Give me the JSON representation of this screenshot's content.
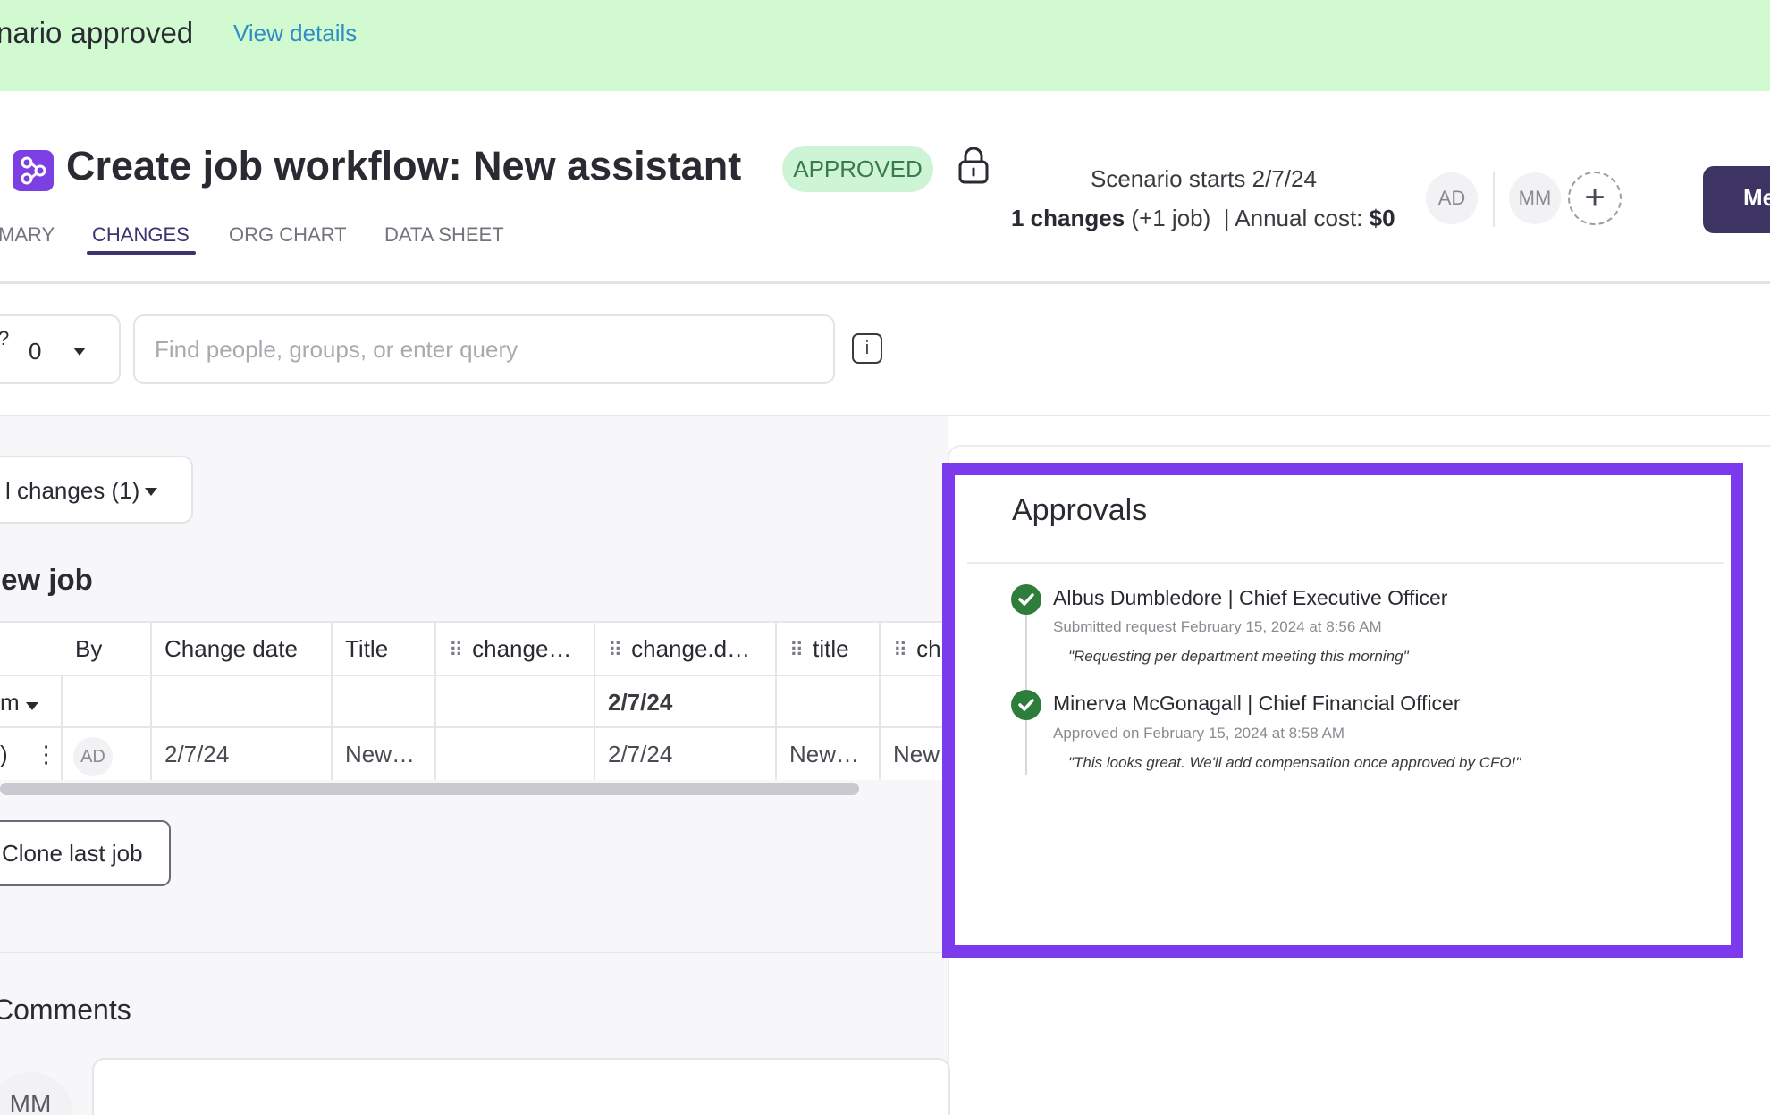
{
  "banner": {
    "message": "nario approved",
    "link": "View details"
  },
  "header": {
    "title": "Create job workflow: New assistant",
    "status_badge": "APPROVED",
    "scenario_starts": "Scenario starts 2/7/24",
    "changes_count": "1 changes",
    "changes_detail": "(+1 job)",
    "annual_cost_label": "Annual cost:",
    "annual_cost_value": "$0",
    "avatars": [
      "AD",
      "MM"
    ],
    "action_button": "Me"
  },
  "tabs": [
    "MARY",
    "CHANGES",
    "ORG CHART",
    "DATA SHEET"
  ],
  "toolbar": {
    "filter_icon": "?",
    "filter_value": "0",
    "search_placeholder": "Find people, groups, or enter query",
    "info_icon": "i"
  },
  "changes_dropdown": {
    "label": "l changes (1)"
  },
  "section": {
    "title": "lew job"
  },
  "table": {
    "columns": [
      "By",
      "Change date",
      "Title",
      "change…",
      "change.d…",
      "title",
      "ch"
    ],
    "group_row": {
      "label": "m",
      "date": "2/7/24"
    },
    "rows": [
      {
        "lead": ")",
        "by": "AD",
        "change_date": "2/7/24",
        "title": "New…",
        "change": "",
        "change_d": "2/7/24",
        "title2": "New…",
        "extra": "New"
      }
    ]
  },
  "clone_button": "Clone last job",
  "comments": {
    "title": "Comments",
    "avatar": "MM"
  },
  "approvals": {
    "title": "Approvals",
    "items": [
      {
        "name": "Albus Dumbledore | Chief Executive Officer",
        "detail": "Submitted request February 15, 2024 at 8:56 AM",
        "note": "\"Requesting per department meeting this morning\""
      },
      {
        "name": "Minerva McGonagall | Chief Financial Officer",
        "detail": "Approved on February 15, 2024 at 8:58 AM",
        "note": "\"This looks great. We'll add compensation once approved by CFO!\""
      }
    ]
  },
  "colors": {
    "banner_bg": "#d1fad1",
    "accent": "#7c3aed",
    "approved_green": "#2e7d3a",
    "primary_button": "#3e3463"
  }
}
